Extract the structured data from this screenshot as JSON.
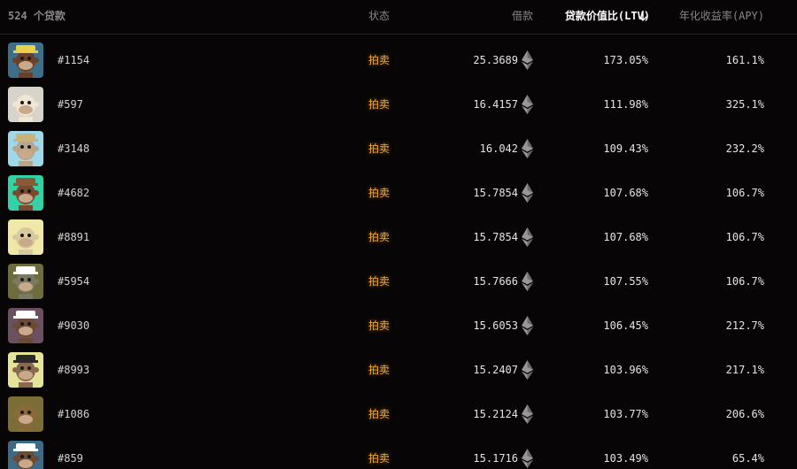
{
  "header": {
    "count_label": "524 个贷款",
    "status_label": "状态",
    "borrow_label": "借款",
    "ltv_label": "贷款价值比(LTV)",
    "apy_label": "年化收益率(APY)"
  },
  "colors": {
    "accent_status": "#f5a623",
    "background": "#070506",
    "text": "#e8e4e6"
  },
  "rows": [
    {
      "id": "#1154",
      "status": "拍卖",
      "borrow": "25.3689",
      "ltv": "173.05%",
      "apy": "161.1%",
      "avatar_bg": "#3d6f8a",
      "fur": "#6b3f2a",
      "hat": "#e8d04a"
    },
    {
      "id": "#597",
      "status": "拍卖",
      "borrow": "16.4157",
      "ltv": "111.98%",
      "apy": "325.1%",
      "avatar_bg": "#d8d4cc",
      "fur": "#efe6d4",
      "hat": ""
    },
    {
      "id": "#3148",
      "status": "拍卖",
      "borrow": "16.042",
      "ltv": "109.43%",
      "apy": "232.2%",
      "avatar_bg": "#9fd8ea",
      "fur": "#b8a68a",
      "hat": "#c8b37a"
    },
    {
      "id": "#4682",
      "status": "拍卖",
      "borrow": "15.7854",
      "ltv": "107.68%",
      "apy": "106.7%",
      "avatar_bg": "#33d1a6",
      "fur": "#7a4a2c",
      "hat": "#8a5a36"
    },
    {
      "id": "#8891",
      "status": "拍卖",
      "borrow": "15.7854",
      "ltv": "107.68%",
      "apy": "106.7%",
      "avatar_bg": "#efe8a8",
      "fur": "#d8c89e",
      "hat": ""
    },
    {
      "id": "#5954",
      "status": "拍卖",
      "borrow": "15.7666",
      "ltv": "107.55%",
      "apy": "106.7%",
      "avatar_bg": "#6e6c3c",
      "fur": "#7a7a62",
      "hat": "#ffffff"
    },
    {
      "id": "#9030",
      "status": "拍卖",
      "borrow": "15.6053",
      "ltv": "106.45%",
      "apy": "212.7%",
      "avatar_bg": "#6a5060",
      "fur": "#6b4a36",
      "hat": "#ffffff"
    },
    {
      "id": "#8993",
      "status": "拍卖",
      "borrow": "15.2407",
      "ltv": "103.96%",
      "apy": "217.1%",
      "avatar_bg": "#e6e49a",
      "fur": "#8a6a4e",
      "hat": "#2a2a2a"
    },
    {
      "id": "#1086",
      "status": "拍卖",
      "borrow": "15.2124",
      "ltv": "103.77%",
      "apy": "206.6%",
      "avatar_bg": "#7a6e36",
      "fur": "#8a6a3a",
      "hat": ""
    },
    {
      "id": "#859",
      "status": "拍卖",
      "borrow": "15.1716",
      "ltv": "103.49%",
      "apy": "65.4%",
      "avatar_bg": "#3d6a86",
      "fur": "#6b4a36",
      "hat": "#ffffff"
    }
  ]
}
